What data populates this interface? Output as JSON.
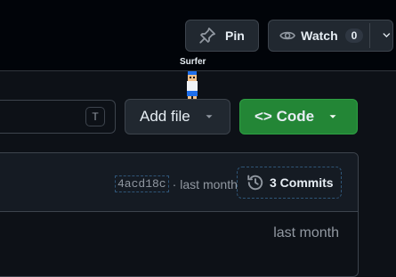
{
  "header": {
    "pin_label": "Pin",
    "watch_label": "Watch",
    "watch_count": "0"
  },
  "cursor": {
    "name": "Surfer"
  },
  "toolbar": {
    "shortcut_key": "T",
    "add_file_label": "Add file",
    "code_label": "<> Code"
  },
  "latest_commit": {
    "hash": "4acd18c",
    "separator": "·",
    "time": "last month",
    "commits_label": "3 Commits"
  },
  "files": [
    {
      "time": "last month"
    }
  ],
  "colors": {
    "background": "#0d1117",
    "button_bg": "#212830",
    "code_green": "#238636",
    "muted_text": "#9198a1"
  }
}
